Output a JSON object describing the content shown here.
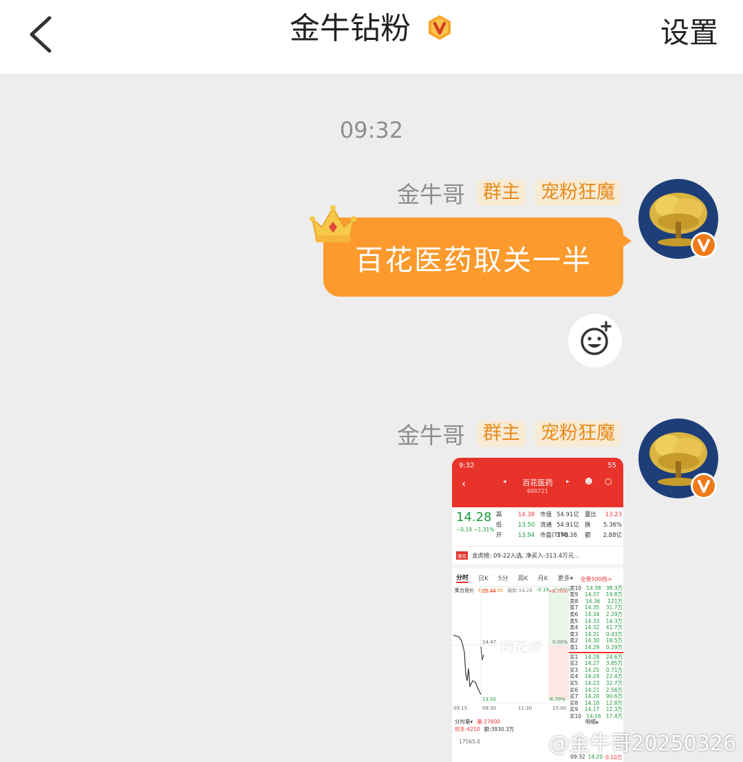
{
  "header": {
    "title": "金牛钻粉",
    "settings_label": "设置"
  },
  "timestamp": "09:32",
  "messages": [
    {
      "sender": "金牛哥",
      "tags": [
        "群主",
        "宠粉狂魔"
      ],
      "text": "百花医药取关一半"
    },
    {
      "sender": "金牛哥",
      "tags": [
        "群主",
        "宠粉狂魔"
      ],
      "image": {
        "status_time": "9:32",
        "battery": "55",
        "stock_name": "百花医药",
        "stock_code": "600721",
        "price": "14.28",
        "change": "−0.19",
        "change_pct": "−1.31%",
        "quote_labels": [
          "高",
          "低",
          "开"
        ],
        "quote_values": [
          "14.38",
          "13.50",
          "13.94"
        ],
        "mid_labels": [
          "市值",
          "流通",
          "市盈(TTM)"
        ],
        "mid_values": [
          "54.91亿",
          "54.91亿",
          "178.38"
        ],
        "right_labels": [
          "量比",
          "换",
          "额"
        ],
        "right_values": [
          "13.23",
          "5.36%",
          "2.88亿"
        ],
        "news": "龙虎榜: 09-22入选, 净买入-313.4万元...",
        "news_tag": "速览",
        "tabs": [
          "分时",
          "日K",
          "5分",
          "周K",
          "月K",
          "更多▾"
        ],
        "sub_labels": [
          "集合竞价",
          "均价:13.95",
          "最新:14.28",
          "-0.19",
          "-1.31%"
        ],
        "chart_labels": {
          "high": "15.44",
          "high_pct": "+6.70%",
          "mid": "14.47",
          "mid_pct": "0.00%",
          "low": "13.50",
          "low_pct": "-6.70%",
          "t1": "09:30",
          "t2": "11:30",
          "t3": "15:00",
          "t0": "09:15",
          "watermark": "同花顺"
        },
        "book_title": "全景500档>",
        "asks": [
          [
            "卖10",
            "14.38",
            "38.3万"
          ],
          [
            "卖9",
            "14.37",
            "19.8万"
          ],
          [
            "卖8",
            "14.36",
            "121万"
          ],
          [
            "卖7",
            "14.35",
            "31.7万"
          ],
          [
            "卖6",
            "14.34",
            "2.29万"
          ],
          [
            "卖5",
            "14.33",
            "14.3万"
          ],
          [
            "卖4",
            "14.32",
            "41.7万"
          ],
          [
            "卖3",
            "14.31",
            "0.43万"
          ],
          [
            "卖2",
            "14.30",
            "18.5万"
          ],
          [
            "卖1",
            "14.29",
            "0.29万"
          ]
        ],
        "bids": [
          [
            "买1",
            "14.28",
            "24.6万"
          ],
          [
            "买2",
            "14.27",
            "3.85万"
          ],
          [
            "买3",
            "14.25",
            "0.71万"
          ],
          [
            "买4",
            "14.24",
            "22.4万"
          ],
          [
            "买5",
            "14.23",
            "32.7万"
          ],
          [
            "买6",
            "14.21",
            "2.56万"
          ],
          [
            "买7",
            "14.20",
            "90.6万"
          ],
          [
            "买8",
            "14.18",
            "12.8万"
          ],
          [
            "买9",
            "14.17",
            "12.3万"
          ],
          [
            "买10",
            "14.16",
            "17.4万"
          ]
        ],
        "bottom": {
          "vol_label": "分时量▾",
          "vol_value": "量:27600",
          "hand": "现手:4210",
          "amount": "额:3930.3万",
          "vol_axis": "17565.0",
          "detail_label": "明细▴",
          "last_time": "09:32",
          "last_price": "14.20",
          "last_vol": "0.10万"
        }
      }
    }
  ],
  "watermark": "@金牛哥20250326",
  "colors": {
    "accent": "#fd9a2d",
    "tag_bg": "#f8ead3",
    "tag_text": "#e88b1c",
    "header_red": "#e8332b"
  },
  "icons": {
    "back": "chevron-left-icon",
    "verified": "v-badge-icon",
    "crown": "crown-icon",
    "emoji": "emoji-reaction-icon"
  }
}
